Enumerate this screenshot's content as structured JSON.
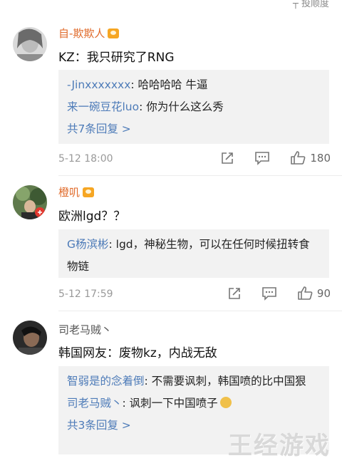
{
  "top_partial_text": "┬ 投顺度",
  "comments": [
    {
      "username": "自-欺欺人",
      "text": "KZ：我只研究了RNG",
      "replies": [
        {
          "name": "-Jinxxxxxxx",
          "text": ": 哈哈哈哈 牛逼"
        },
        {
          "name": "来一碗豆花luo",
          "text": ": 你为什么这么秀"
        }
      ],
      "more_replies": "共7条回复 >",
      "time": "5-12 18:00",
      "likes": "180"
    },
    {
      "username": "橙叽",
      "text": "欧洲lgd？？",
      "replies": [
        {
          "name": "G杨滨彬",
          "text": ": lgd，神秘生物，可以在任何时候扭转食物链"
        }
      ],
      "time": "5-12 17:59",
      "likes": "90"
    },
    {
      "username": "司老马贼丶",
      "text": "韩国网友：废物kz，内战无敌",
      "replies": [
        {
          "name": "智弱是的念着倒",
          "text": ": 不需要讽刺，韩国喷的比中国狠"
        },
        {
          "name": "司老马贼丶",
          "text": ": 讽刺一下中国喷子"
        }
      ],
      "more_replies": "共3条回复 >"
    }
  ],
  "watermark": "王经游戏",
  "colors": {
    "username": "#e06b2b",
    "link": "#4d7bb8",
    "reply_bg": "#f2f2f2"
  },
  "icons": [
    "share-icon",
    "comment-icon",
    "like-icon",
    "verified-badge-icon",
    "doge-emoji-icon"
  ]
}
